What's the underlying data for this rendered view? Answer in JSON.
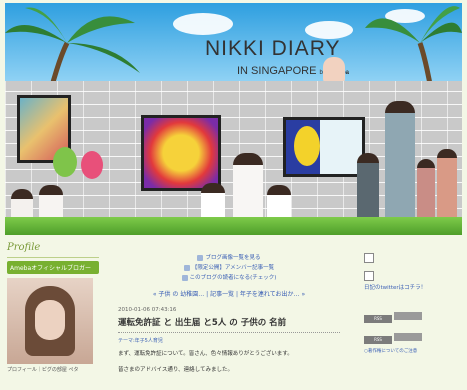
{
  "header": {
    "title": "NIKKI DIARY",
    "subtitle": "IN SINGAPORE",
    "subtitle_by": "by",
    "subtitle_brand": "Ameba"
  },
  "sidebar": {
    "title": "Profile",
    "badge": "Amebaオフィシャルブロガー",
    "caption": "プロフィール｜ピグの部屋 ペタ"
  },
  "main": {
    "links": [
      "ブログ画像一覧を見る",
      "【限定公開】アメンバー記事一覧",
      "このブログの読者になる(チェック)"
    ],
    "nav": "« 子供 の 幼稚園… | 記事一覧 | 年子を連れてお出か… »",
    "date": "2010-01-06 07:43:16",
    "entry_title": "運転免許証 と 出生届 と5人 の 子供の 名前",
    "theme": "テーマ:年子5人育児",
    "body_line1": "まず、運転免許証について。皆さん、色々情報ありがとうございます。",
    "body_line2": "皆さまのアドバイス通り、連絡してみました。"
  },
  "right": {
    "twitter": "日記のtwitterはコチラ！",
    "rss_label": "RSS",
    "small_link": "○著作権についてのご注意"
  },
  "colors": {
    "page_bg": "#f3f7e6",
    "link": "#3a5fb5",
    "accent_green": "#78b030"
  }
}
